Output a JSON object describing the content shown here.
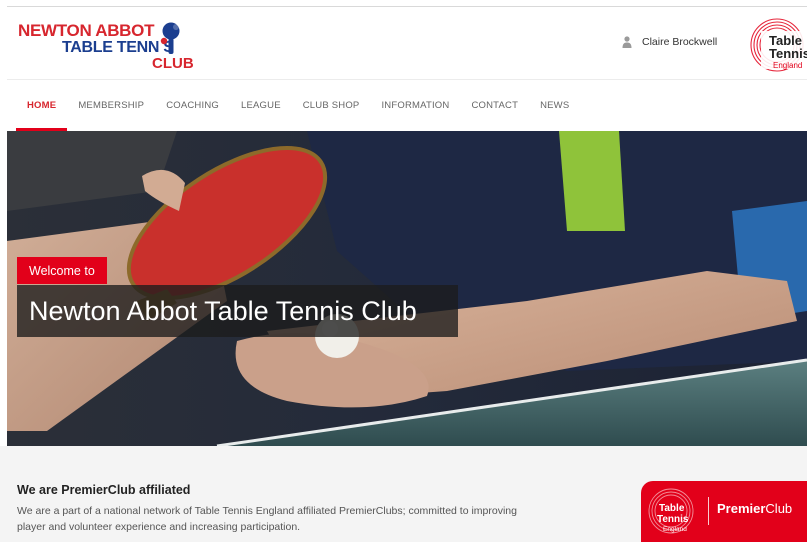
{
  "header": {
    "logo": {
      "line1": "NEWTON ABBOT",
      "line2": "TABLE TENN S",
      "line3": "CLUB"
    },
    "user": {
      "icon": "user-icon",
      "name": "Claire Brockwell"
    },
    "partner_logo": {
      "line1": "Table",
      "line2": "Tennis",
      "line3": "England"
    }
  },
  "nav": {
    "items": [
      {
        "label": "HOME",
        "active": true
      },
      {
        "label": "MEMBERSHIP"
      },
      {
        "label": "COACHING"
      },
      {
        "label": "LEAGUE"
      },
      {
        "label": "CLUB SHOP"
      },
      {
        "label": "INFORMATION"
      },
      {
        "label": "CONTACT"
      },
      {
        "label": "NEWS"
      }
    ]
  },
  "hero": {
    "badge": "Welcome to",
    "title": "Newton Abbot Table Tennis Club"
  },
  "premier": {
    "heading": "We are PremierClub affiliated",
    "text": "We are a part of a national network of Table Tennis England affiliated PremierClubs; committed to improving player and volunteer experience and increasing participation.",
    "logo": {
      "tte_line1": "Table",
      "tte_line2": "Tennis",
      "tte_line3": "England",
      "brand_bold": "Premier",
      "brand_rest": "Club"
    }
  },
  "colors": {
    "accent": "#e2001a",
    "logo_red": "#d7262e",
    "logo_blue": "#1b3e8f"
  }
}
